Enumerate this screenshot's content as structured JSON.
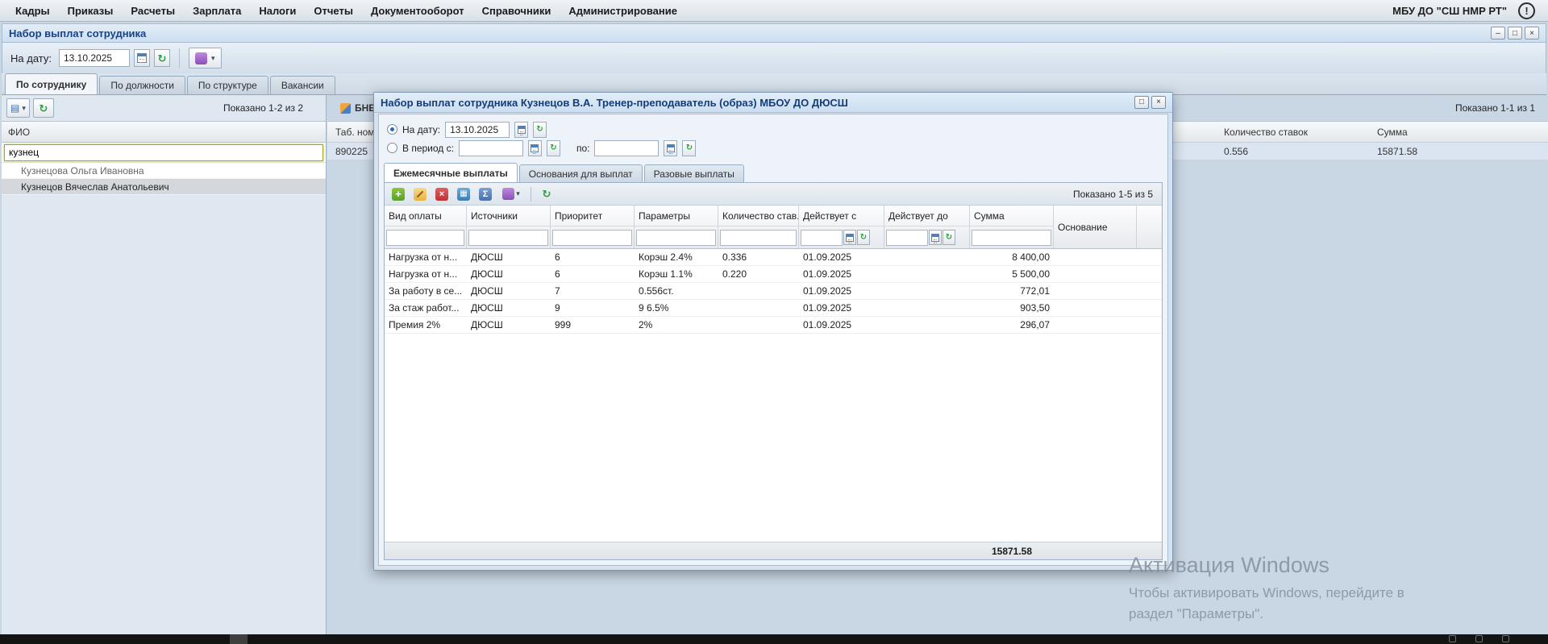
{
  "icons": {
    "info": "!",
    "minimize": "–",
    "restore": "□",
    "close": "×",
    "chevron_down": "▾",
    "refresh": "↻",
    "add": "+",
    "delete": "×",
    "copy": "▦",
    "sum": "Σ",
    "export": "▤"
  },
  "menubar": {
    "items": [
      {
        "label": "Кадры"
      },
      {
        "label": "Приказы"
      },
      {
        "label": "Расчеты"
      },
      {
        "label": "Зарплата"
      },
      {
        "label": "Налоги"
      },
      {
        "label": "Отчеты"
      },
      {
        "label": "Документооборот"
      },
      {
        "label": "Справочники"
      },
      {
        "label": "Администрирование"
      }
    ],
    "org": "МБУ ДО \"СШ НМР РТ\""
  },
  "panel": {
    "title": "Набор выплат сотрудника",
    "date_label": "На дату:",
    "date_value": "13.10.2025"
  },
  "view_tabs": {
    "employee": "По сотруднику",
    "position": "По должности",
    "structure": "По структуре",
    "vacancies": "Вакансии"
  },
  "left_panel": {
    "shown": "Показано 1-2 из 2",
    "column_fio": "ФИО",
    "filter_value": "кузнец",
    "rows": [
      {
        "name": "Кузнецова Ольга Ивановна"
      },
      {
        "name": "Кузнецов Вячеслав Анатольевич"
      }
    ]
  },
  "right_panel": {
    "partial_label": "БНЕВ",
    "shown": "Показано 1-1 из 1",
    "col_tab_num": "Таб. ном...",
    "col_rates": "Количество ставок",
    "col_sum": "Сумма",
    "row": {
      "tab_num": "890225",
      "rates": "0.556",
      "sum": "15871.58"
    }
  },
  "modal": {
    "title": "Набор выплат сотрудника Кузнецов В.А. Тренер-преподаватель (образ) МБОУ ДО ДЮСШ",
    "on_date_label": "На дату:",
    "on_date_value": "13.10.2025",
    "period_label": "В период с:",
    "period_from_value": "",
    "period_to_label": "по:",
    "period_to_value": "",
    "tabs": {
      "monthly": "Ежемесячные выплаты",
      "grounds": "Основания для выплат",
      "onetime": "Разовые выплаты"
    },
    "shown": "Показано 1-5 из 5",
    "grid": {
      "columns": [
        "Вид оплаты",
        "Источники",
        "Приоритет",
        "Параметры",
        "Количество став...",
        "Действует с",
        "Действует до",
        "Сумма",
        "Основание"
      ],
      "rows": [
        {
          "type": "Нагрузка от н...",
          "source": "ДЮСШ",
          "priority": "6",
          "params": "Корэш 2.4%",
          "rates": "0.336",
          "from": "01.09.2025",
          "to": "",
          "sum": "8 400,00"
        },
        {
          "type": "Нагрузка от н...",
          "source": "ДЮСШ",
          "priority": "6",
          "params": "Корэш 1.1%",
          "rates": "0.220",
          "from": "01.09.2025",
          "to": "",
          "sum": "5 500,00"
        },
        {
          "type": "За работу в се...",
          "source": "ДЮСШ",
          "priority": "7",
          "params": "0.556ст.",
          "rates": "",
          "from": "01.09.2025",
          "to": "",
          "sum": "772,01"
        },
        {
          "type": "За стаж работ...",
          "source": "ДЮСШ",
          "priority": "9",
          "params": "9 6.5%",
          "rates": "",
          "from": "01.09.2025",
          "to": "",
          "sum": "903,50"
        },
        {
          "type": "Премия 2%",
          "source": "ДЮСШ",
          "priority": "999",
          "params": "2%",
          "rates": "",
          "from": "01.09.2025",
          "to": "",
          "sum": "296,07"
        }
      ],
      "total": "15871.58"
    }
  },
  "watermark": {
    "line1": "Активация Windows",
    "line2": "Чтобы активировать Windows, перейдите в",
    "line3": "раздел \"Параметры\"."
  }
}
